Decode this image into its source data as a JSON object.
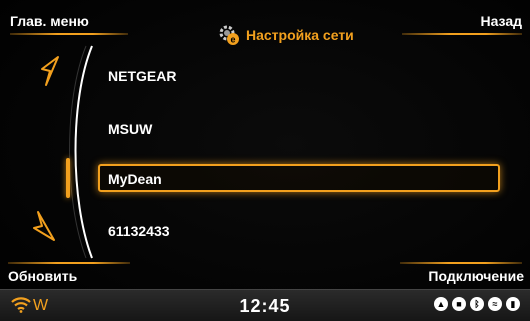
{
  "header": {
    "menu_label": "Глав. меню",
    "back_label": "Назад",
    "title": "Настройка сети"
  },
  "networks": [
    "NETGEAR",
    "MSUW",
    "MyDean",
    "61132433"
  ],
  "selected_network": "MyDean",
  "footer": {
    "refresh_label": "Обновить",
    "connect_label": "Подключение"
  },
  "status_bar": {
    "time": "12:45",
    "wifi_suffix": "W",
    "icons": [
      "navigation-icon",
      "camera-icon",
      "bluetooth-icon",
      "wifi-icon",
      "signal-icon"
    ]
  },
  "colors": {
    "accent": "#f2a01e",
    "background": "#000000",
    "text": "#ffffff"
  }
}
